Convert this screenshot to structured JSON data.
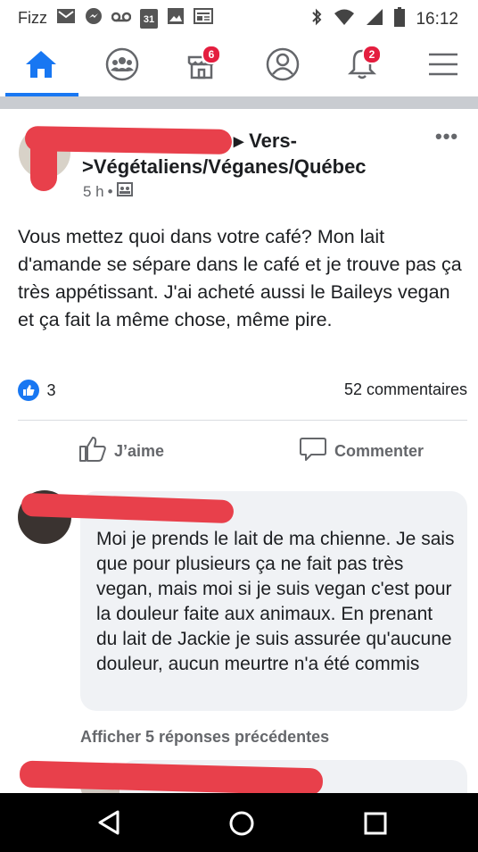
{
  "status_bar": {
    "carrier": "Fizz",
    "time": "16:12",
    "calendar_day": "31",
    "icons": [
      "gmail-icon",
      "messenger-icon",
      "voicemail-icon",
      "calendar-icon",
      "image-icon",
      "news-icon",
      "bluetooth-icon",
      "wifi-icon",
      "signal-icon",
      "battery-icon"
    ]
  },
  "nav": {
    "items": [
      {
        "name": "home",
        "icon": "home-icon",
        "active": true
      },
      {
        "name": "groups",
        "icon": "groups-icon"
      },
      {
        "name": "marketplace",
        "icon": "marketplace-icon",
        "badge": "6"
      },
      {
        "name": "profile",
        "icon": "profile-icon"
      },
      {
        "name": "notifications",
        "icon": "bell-icon",
        "badge": "2"
      },
      {
        "name": "menu",
        "icon": "menu-icon"
      }
    ],
    "accent": "#1877f2",
    "badge_color": "#e41e3f"
  },
  "post": {
    "group_line1": "▸ Vers-",
    "group_line2": ">Végétaliens/Véganes/Québec",
    "time": "5 h",
    "separator": "•",
    "audience_icon": "group-audience-icon",
    "more_label": "•••",
    "text": "Vous mettez quoi dans votre café? Mon lait d'amande se sépare dans le café et je trouve pas ça très appétissant. J'ai acheté aussi le Baileys vegan et ça fait la même chose, même pire.",
    "reactions_count": "3",
    "comments_count": "52 commentaires",
    "like_label": "J’aime",
    "comment_label": "Commenter"
  },
  "comment": {
    "text": "Moi je prends le lait de ma chienne. Je sais que pour plusieurs ça ne fait pas très vegan, mais moi si je suis vegan c'est pour la douleur faite aux animaux. En prenant du lait de Jackie je suis assurée qu'aucune douleur, aucun meurtre n'a été commis"
  },
  "replies": {
    "label": "Afficher 5 réponses précédentes"
  },
  "android_nav": {
    "icons": [
      "back-icon",
      "home-circle-icon",
      "recents-icon"
    ]
  }
}
